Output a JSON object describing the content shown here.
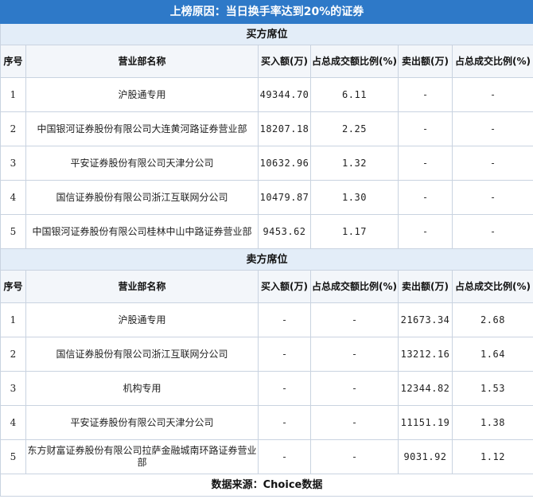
{
  "title": "上榜原因：当日换手率达到20%的证券",
  "buy": {
    "section_label": "买方席位",
    "columns": [
      "序号",
      "营业部名称",
      "买入额(万)",
      "占总成交额比例(%)",
      "卖出额(万)",
      "占总成交比例(%)"
    ],
    "rows": [
      {
        "idx": "1",
        "name": "沪股通专用",
        "buy_amt": "49344.70",
        "buy_pct": "6.11",
        "sell_amt": "-",
        "sell_pct": "-"
      },
      {
        "idx": "2",
        "name": "中国银河证券股份有限公司大连黄河路证券营业部",
        "buy_amt": "18207.18",
        "buy_pct": "2.25",
        "sell_amt": "-",
        "sell_pct": "-"
      },
      {
        "idx": "3",
        "name": "平安证券股份有限公司天津分公司",
        "buy_amt": "10632.96",
        "buy_pct": "1.32",
        "sell_amt": "-",
        "sell_pct": "-"
      },
      {
        "idx": "4",
        "name": "国信证券股份有限公司浙江互联网分公司",
        "buy_amt": "10479.87",
        "buy_pct": "1.30",
        "sell_amt": "-",
        "sell_pct": "-"
      },
      {
        "idx": "5",
        "name": "中国银河证券股份有限公司桂林中山中路证券营业部",
        "buy_amt": "9453.62",
        "buy_pct": "1.17",
        "sell_amt": "-",
        "sell_pct": "-"
      }
    ]
  },
  "sell": {
    "section_label": "卖方席位",
    "columns": [
      "序号",
      "营业部名称",
      "买入额(万)",
      "占总成交额比例(%)",
      "卖出额(万)",
      "占总成交比例(%)"
    ],
    "rows": [
      {
        "idx": "1",
        "name": "沪股通专用",
        "buy_amt": "-",
        "buy_pct": "-",
        "sell_amt": "21673.34",
        "sell_pct": "2.68"
      },
      {
        "idx": "2",
        "name": "国信证券股份有限公司浙江互联网分公司",
        "buy_amt": "-",
        "buy_pct": "-",
        "sell_amt": "13212.16",
        "sell_pct": "1.64"
      },
      {
        "idx": "3",
        "name": "机构专用",
        "buy_amt": "-",
        "buy_pct": "-",
        "sell_amt": "12344.82",
        "sell_pct": "1.53"
      },
      {
        "idx": "4",
        "name": "平安证券股份有限公司天津分公司",
        "buy_amt": "-",
        "buy_pct": "-",
        "sell_amt": "11151.19",
        "sell_pct": "1.38"
      },
      {
        "idx": "5",
        "name": "东方财富证券股份有限公司拉萨金融城南环路证券营业部",
        "buy_amt": "-",
        "buy_pct": "-",
        "sell_amt": "9031.92",
        "sell_pct": "1.12"
      }
    ]
  },
  "source": "数据来源：Choice数据"
}
